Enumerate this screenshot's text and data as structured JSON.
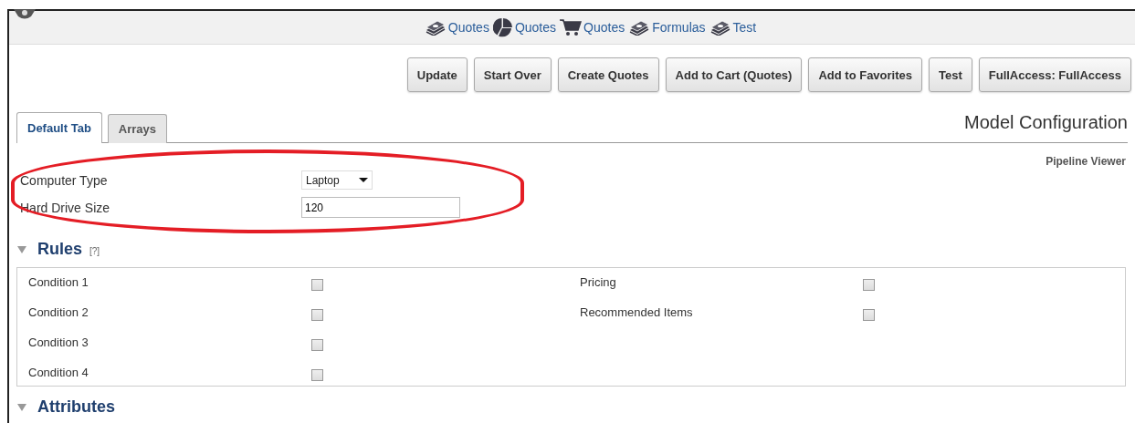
{
  "nav": [
    {
      "kind": "money",
      "label": "Quotes"
    },
    {
      "kind": "pie",
      "label": "Quotes"
    },
    {
      "kind": "cart",
      "label": "Quotes"
    },
    {
      "kind": "money",
      "label": "Formulas"
    },
    {
      "kind": "money",
      "label": "Test"
    }
  ],
  "buttons": [
    "Update",
    "Start Over",
    "Create Quotes",
    "Add to Cart (Quotes)",
    "Add to Favorites",
    "Test",
    "FullAccess: FullAccess"
  ],
  "tabs": [
    {
      "label": "Default Tab",
      "selected": true
    },
    {
      "label": "Arrays",
      "selected": false
    }
  ],
  "page_title": "Model Configuration",
  "pipeline_link": "Pipeline Viewer",
  "fields": [
    {
      "kind": "select",
      "label": "Computer Type",
      "value": "Laptop"
    },
    {
      "kind": "text",
      "label": "Hard Drive Size",
      "value": "120"
    }
  ],
  "sections": [
    {
      "title": "Rules",
      "help": "[?]",
      "expanded": true,
      "columns": [
        [
          {
            "label": "Condition 1",
            "checked": false
          },
          {
            "label": "Condition 2",
            "checked": false
          },
          {
            "label": "Condition 3",
            "checked": false
          },
          {
            "label": "Condition 4",
            "checked": false
          }
        ],
        [
          {
            "label": "Pricing",
            "checked": false
          },
          {
            "label": "Recommended Items",
            "checked": false
          }
        ]
      ]
    },
    {
      "title": "Attributes",
      "expanded": true
    }
  ]
}
